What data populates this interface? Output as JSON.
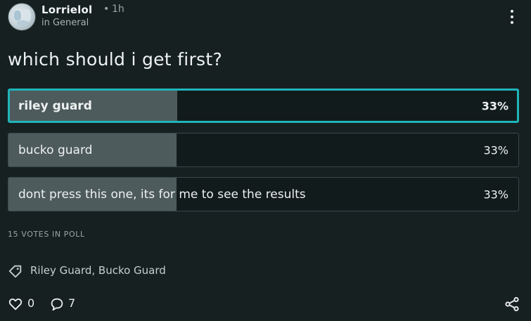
{
  "post": {
    "author": "Lorrielol",
    "separator": "•",
    "time": "1h",
    "category": "in General",
    "question": "which should i get first?"
  },
  "poll": {
    "options": [
      {
        "label": "riley guard",
        "percent_text": "33%",
        "percent": 33,
        "selected": true
      },
      {
        "label": "bucko guard",
        "percent_text": "33%",
        "percent": 33,
        "selected": false
      },
      {
        "label": "dont press this one, its for me to see the results",
        "percent_text": "33%",
        "percent": 33,
        "selected": false
      }
    ],
    "votes_text": "15 VOTES IN POLL"
  },
  "tags": {
    "text": "Riley Guard, Bucko Guard"
  },
  "footer": {
    "likes": "0",
    "comments": "7"
  },
  "icons": {
    "menu": "more-vertical-icon",
    "tag": "tag-icon",
    "like": "heart-icon",
    "comment": "comment-icon",
    "share": "share-icon"
  },
  "colors": {
    "background": "#162021",
    "accent": "#1fb5b8",
    "result_fill": "#4e5b5d"
  }
}
